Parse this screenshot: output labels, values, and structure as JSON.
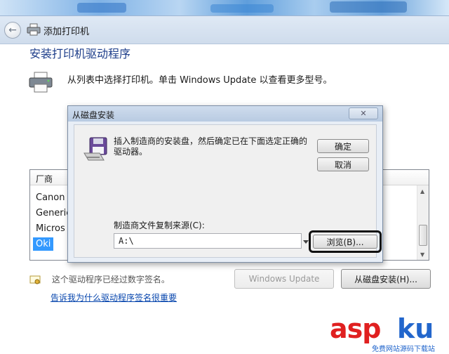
{
  "wizard": {
    "title": "添加打印机",
    "heading": "安装打印机驱动程序",
    "description": "从列表中选择打印机。单击 Windows Update 以查看更多型号。",
    "list": {
      "header": "厂商",
      "items": [
        "Canon",
        "Generic",
        "Micros",
        "Oki"
      ],
      "selected_index": 3
    },
    "signature_text": "这个驱动程序已经过数字签名。",
    "signature_link": "告诉我为什么驱动程序签名很重要",
    "buttons": {
      "windows_update": "Windows Update",
      "have_disk": "从磁盘安装(H)..."
    }
  },
  "dialog": {
    "title": "从磁盘安装",
    "close_label": "✕",
    "message": "插入制造商的安装盘，然后确定已在下面选定正确的驱动器。",
    "ok": "确定",
    "cancel": "取消",
    "source_label": "制造商文件复制来源(C):",
    "source_value": "A:\\",
    "browse": "浏览(B)..."
  },
  "watermark": {
    "brand_a": "asp",
    "brand_b": "ku",
    "tagline": "免费网站源码下载站"
  },
  "colors": {
    "heading": "#1e3e8a",
    "selection": "#3399ff",
    "link": "#0645ad",
    "watermark_red": "#e02020",
    "watermark_blue": "#2266cc"
  }
}
